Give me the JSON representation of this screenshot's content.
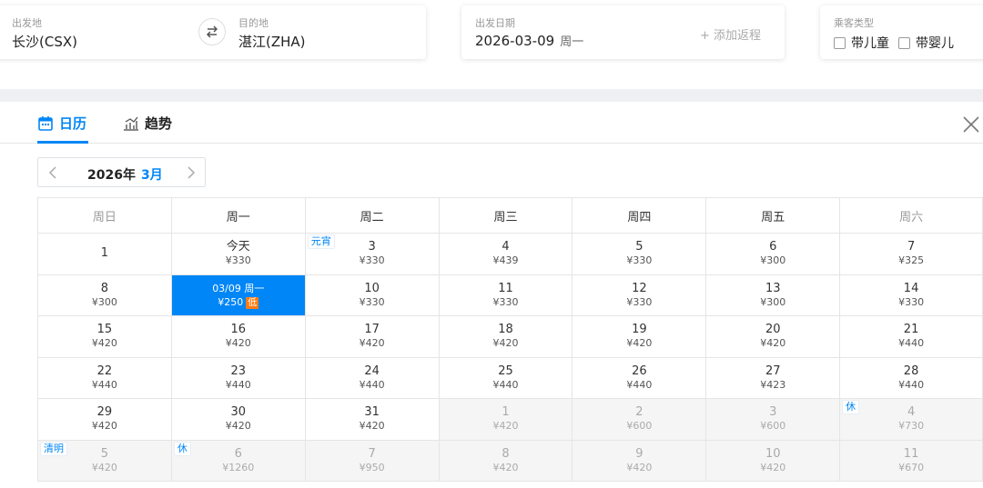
{
  "search": {
    "from_label": "出发地",
    "from_value": "长沙(CSX)",
    "to_label": "目的地",
    "to_value": "湛江(ZHA)",
    "date_label": "出发日期",
    "date_value": "2026-03-09",
    "date_weekday": "周一",
    "add_return": "+ 添加返程",
    "passenger_label": "乘客类型",
    "option_child": "带儿童",
    "option_infant": "带婴儿"
  },
  "tabs": {
    "calendar": "日历",
    "trend": "趋势"
  },
  "month_nav": {
    "year": "2026年",
    "month": "3月"
  },
  "weekdays": [
    "周日",
    "周一",
    "周二",
    "周三",
    "周四",
    "周五",
    "周六"
  ],
  "weeks": [
    [
      {
        "day": "1",
        "price": ""
      },
      {
        "day": "今天",
        "price": "¥330"
      },
      {
        "day": "3",
        "price": "¥330",
        "tag": "元宵"
      },
      {
        "day": "4",
        "price": "¥439"
      },
      {
        "day": "5",
        "price": "¥330"
      },
      {
        "day": "6",
        "price": "¥300"
      },
      {
        "day": "7",
        "price": "¥325"
      }
    ],
    [
      {
        "day": "8",
        "price": "¥300"
      },
      {
        "day": "03/09 周一",
        "price": "¥250",
        "selected": true,
        "badge": "低"
      },
      {
        "day": "10",
        "price": "¥330"
      },
      {
        "day": "11",
        "price": "¥330"
      },
      {
        "day": "12",
        "price": "¥330"
      },
      {
        "day": "13",
        "price": "¥300"
      },
      {
        "day": "14",
        "price": "¥330"
      }
    ],
    [
      {
        "day": "15",
        "price": "¥420"
      },
      {
        "day": "16",
        "price": "¥420"
      },
      {
        "day": "17",
        "price": "¥420"
      },
      {
        "day": "18",
        "price": "¥420"
      },
      {
        "day": "19",
        "price": "¥420"
      },
      {
        "day": "20",
        "price": "¥420"
      },
      {
        "day": "21",
        "price": "¥440"
      }
    ],
    [
      {
        "day": "22",
        "price": "¥440"
      },
      {
        "day": "23",
        "price": "¥440"
      },
      {
        "day": "24",
        "price": "¥440"
      },
      {
        "day": "25",
        "price": "¥440"
      },
      {
        "day": "26",
        "price": "¥440"
      },
      {
        "day": "27",
        "price": "¥423"
      },
      {
        "day": "28",
        "price": "¥440"
      }
    ],
    [
      {
        "day": "29",
        "price": "¥420"
      },
      {
        "day": "30",
        "price": "¥420"
      },
      {
        "day": "31",
        "price": "¥420"
      },
      {
        "day": "1",
        "price": "¥420",
        "other": true
      },
      {
        "day": "2",
        "price": "¥600",
        "other": true
      },
      {
        "day": "3",
        "price": "¥600",
        "other": true
      },
      {
        "day": "4",
        "price": "¥730",
        "other": true,
        "tag": "休"
      }
    ],
    [
      {
        "day": "5",
        "price": "¥420",
        "other": true,
        "tag": "清明"
      },
      {
        "day": "6",
        "price": "¥1260",
        "other": true,
        "tag": "休"
      },
      {
        "day": "7",
        "price": "¥950",
        "other": true
      },
      {
        "day": "8",
        "price": "¥420",
        "other": true
      },
      {
        "day": "9",
        "price": "¥420",
        "other": true
      },
      {
        "day": "10",
        "price": "¥420",
        "other": true
      },
      {
        "day": "11",
        "price": "¥670",
        "other": true
      }
    ]
  ]
}
